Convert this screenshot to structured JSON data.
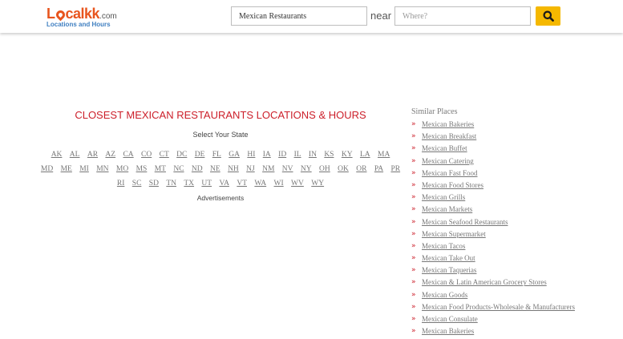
{
  "header": {
    "logo_text": "Localkk",
    "logo_domain": ".com",
    "logo_tagline": "Locations and Hours",
    "search_what_value": "Mexican Restaurants",
    "near_label": "near",
    "search_where_placeholder": "Where?",
    "search_icon": "search-icon",
    "accent_color": "#f5b800"
  },
  "main": {
    "title": "CLOSEST MEXICAN RESTAURANTS LOCATIONS & HOURS",
    "title_color": "#cc1f2a",
    "select_state_label": "Select Your State",
    "state_rows": [
      [
        "AK",
        "AL",
        "AR",
        "AZ",
        "CA",
        "CO",
        "CT",
        "DC",
        "DE",
        "FL",
        "GA",
        "HI",
        "IA",
        "ID",
        "IL",
        "IN",
        "KS",
        "KY",
        "LA",
        "MA"
      ],
      [
        "MD",
        "ME",
        "MI",
        "MN",
        "MO",
        "MS",
        "MT",
        "NC",
        "ND",
        "NE",
        "NH",
        "NJ",
        "NM",
        "NV",
        "NY",
        "OH",
        "OK",
        "OR",
        "PA",
        "PR"
      ],
      [
        "RI",
        "SC",
        "SD",
        "TN",
        "TX",
        "UT",
        "VA",
        "VT",
        "WA",
        "WI",
        "WV",
        "WY"
      ]
    ],
    "ads_label": "Advertisements"
  },
  "sidebar": {
    "title": "Similar Places",
    "bullet_icon": "chevron-right-icon",
    "items": [
      "Mexican Bakeries",
      "Mexican Breakfast",
      "Mexican Buffet",
      "Mexican Catering",
      "Mexican Fast Food",
      "Mexican Food Stores",
      "Mexican Grills",
      "Mexican Markets",
      "Mexican Seafood Restaurants",
      "Mexican Supermarket",
      "Mexican Tacos",
      "Mexican Take Out",
      "Mexican Taquerias",
      "Mexican & Latin American Grocery Stores",
      "Mexican Goods",
      "Mexican Food Products-Wholesale & Manufacturers",
      "Mexican Consulate",
      "Mexican Bakeries"
    ]
  }
}
